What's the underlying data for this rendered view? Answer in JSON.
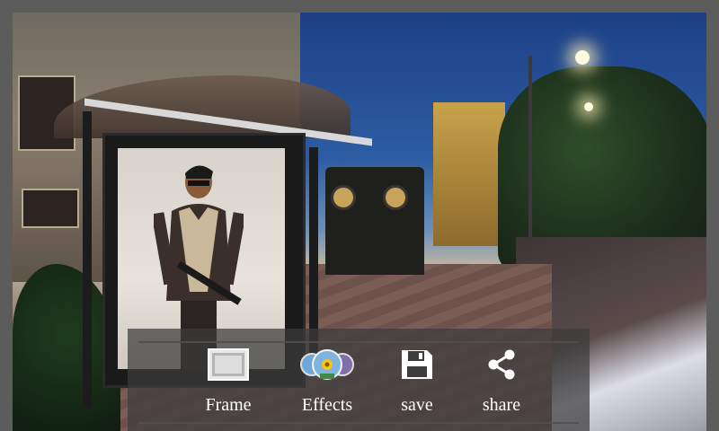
{
  "toolbar": {
    "items": [
      {
        "label": "Frame",
        "icon": "frame-icon"
      },
      {
        "label": "Effects",
        "icon": "effects-icon"
      },
      {
        "label": "save",
        "icon": "save-icon"
      },
      {
        "label": "share",
        "icon": "share-icon"
      }
    ]
  },
  "colors": {
    "toolbar_bg": "#3c3c3c",
    "label": "#ffffff",
    "sky": "#1d3f86"
  }
}
